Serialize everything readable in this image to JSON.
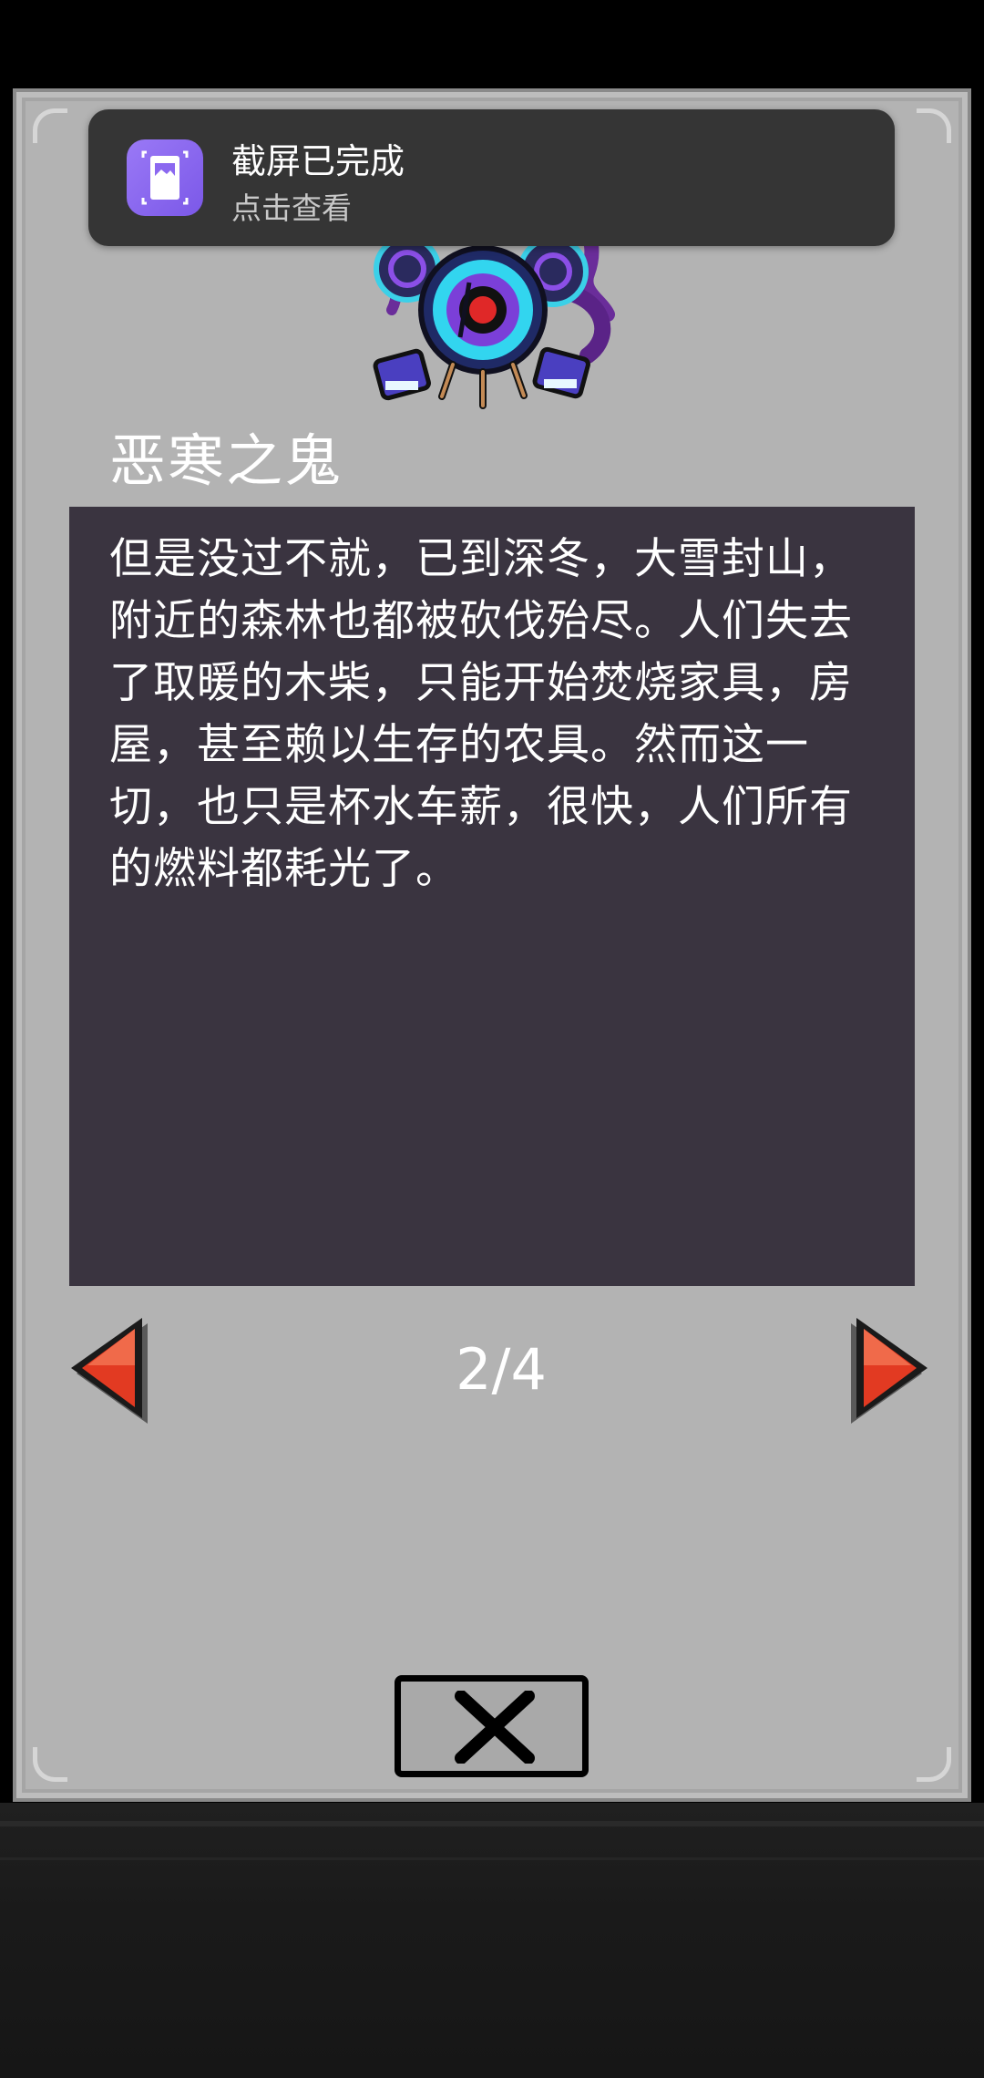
{
  "notification": {
    "title": "截屏已完成",
    "subtitle": "点击查看",
    "icon": "screenshot-gallery-icon",
    "icon_color": "#8b68f0"
  },
  "dialog": {
    "character_name": "恶寒之鬼",
    "character_image": "cold-ghost-eyeball-sprite",
    "story_text": "但是没过不就，已到深冬，大雪封山，附近的森林也都被砍伐殆尽。人们失去了取暖的木柴，只能开始焚烧家具，房屋，甚至赖以生存的农具。然而这一切，也只是杯水车薪，很快，人们所有的燃料都耗光了。",
    "page": "2/4",
    "prev_icon": "red-left-arrow-icon",
    "next_icon": "red-right-arrow-icon",
    "close_icon": "close-x-icon"
  },
  "colors": {
    "panel": "#b3b3b3",
    "text_box": "#3a3440",
    "arrow_red": "#e23a22"
  }
}
